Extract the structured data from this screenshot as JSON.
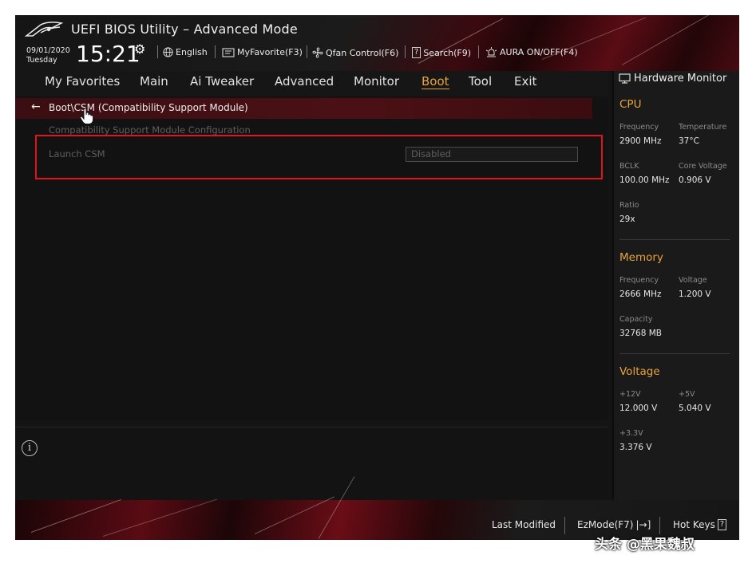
{
  "header": {
    "title": "UEFI BIOS Utility – Advanced Mode",
    "date": "09/01/2020",
    "weekday": "Tuesday",
    "time": "15:21",
    "buttons": {
      "language": "English",
      "myfavorite": "MyFavorite(F3)",
      "qfan": "Qfan Control(F6)",
      "search": "Search(F9)",
      "aura": "AURA ON/OFF(F4)"
    }
  },
  "nav": {
    "tabs": [
      "My Favorites",
      "Main",
      "Ai Tweaker",
      "Advanced",
      "Monitor",
      "Boot",
      "Tool",
      "Exit"
    ],
    "active": "Boot"
  },
  "main": {
    "breadcrumb": "Boot\\CSM (Compatibility Support Module)",
    "section_title": "Compatibility Support Module Configuration",
    "items": [
      {
        "label": "Launch CSM",
        "value": "Disabled"
      }
    ]
  },
  "hardware_monitor": {
    "title": "Hardware Monitor",
    "cpu": {
      "title": "CPU",
      "frequency_label": "Frequency",
      "frequency": "2900 MHz",
      "temperature_label": "Temperature",
      "temperature": "37°C",
      "bclk_label": "BCLK",
      "bclk": "100.00 MHz",
      "core_voltage_label": "Core Voltage",
      "core_voltage": "0.906 V",
      "ratio_label": "Ratio",
      "ratio": "29x"
    },
    "memory": {
      "title": "Memory",
      "frequency_label": "Frequency",
      "frequency": "2666 MHz",
      "voltage_label": "Voltage",
      "voltage": "1.200 V",
      "capacity_label": "Capacity",
      "capacity": "32768 MB"
    },
    "voltage": {
      "title": "Voltage",
      "v12_label": "+12V",
      "v12": "12.000 V",
      "v5_label": "+5V",
      "v5": "5.040 V",
      "v33_label": "+3.3V",
      "v33": "3.376 V"
    }
  },
  "footer": {
    "last_modified": "Last Modified",
    "ezmode": "EzMode(F7)",
    "hotkeys": "Hot Keys"
  },
  "watermark": "头条 @黑果魏叔",
  "colors": {
    "accent": "#e8a23c",
    "highlight_box": "#e0141e",
    "background": "#141414"
  },
  "icons": [
    "rog-logo-icon",
    "gear-icon",
    "globe-icon",
    "myfavorite-icon",
    "fan-icon",
    "search-icon",
    "aura-icon",
    "back-arrow-icon",
    "hand-cursor-icon",
    "info-icon",
    "monitor-icon",
    "exit-arrow-icon",
    "question-icon"
  ]
}
